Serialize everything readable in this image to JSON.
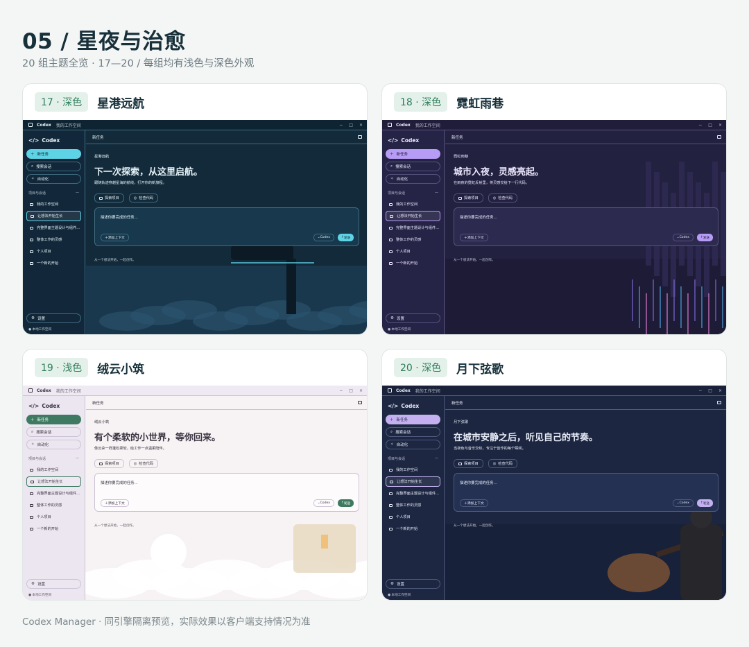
{
  "page": {
    "title": "05 / 星夜与治愈",
    "subtitle": "20 组主题全览 · 17—20 / 每组均有浅色与深色外观",
    "footer": "Codex Manager · 同引擎隔离预览，实际效果以客户端支持情况为准"
  },
  "ui": {
    "app_name": "Codex",
    "workspace": "我的工作空间",
    "new_task": "新任务",
    "search": "搜索会话",
    "automation": "自动化",
    "projects_section": "项目与会话",
    "projects": [
      "我的工作空间",
      "让想法开始生长",
      "完整界面主题设计与组件...",
      "整体工作的灵感",
      "个人项目",
      "一个新的开始"
    ],
    "settings": "设置",
    "local": "本地工作空间",
    "main_header": "新任务",
    "pill_project": "探索项目",
    "pill_review": "检查代码",
    "composer_placeholder": "描述你要完成的任务...",
    "add_context": "添加上下文",
    "model": "Codex",
    "send": "发送",
    "hint": "从一个想法开始，一起创作。"
  },
  "cards": [
    {
      "badge": "17 · 深色",
      "name": "星港远航",
      "kicker": "星港远航",
      "headline": "下一次探索，从这里启航。",
      "desc": "跟随轨迹穿越星海的航线，打开你的新旅程。",
      "colors": {
        "bg": "#132a3a",
        "sidebar": "#12283a",
        "titlebar": "#0f2433",
        "text": "#e6f3f8",
        "accent": "#5fd3e6",
        "accent_text": "#0d2533",
        "line": "#3f6c80",
        "composer": "#18394d"
      }
    },
    {
      "badge": "18 · 深色",
      "name": "霓虹雨巷",
      "kicker": "霓虹雨巷",
      "headline": "城市入夜，灵感亮起。",
      "desc": "在雨夜的霓虹反射里，将灵感交给下一行代码。",
      "colors": {
        "bg": "#22213f",
        "sidebar": "#262446",
        "titlebar": "#1f1d3a",
        "text": "#ece8ff",
        "accent": "#b69cf4",
        "accent_text": "#231d3d",
        "line": "#58527e",
        "composer": "#2c2a4e"
      }
    },
    {
      "badge": "19 · 浅色",
      "name": "绒云小筑",
      "kicker": "绒云小筑",
      "headline": "有个柔软的小世界，等你回来。",
      "desc": "像云朵一样蓬松柔软，给工作一点温柔陪伴。",
      "colors": {
        "bg": "#f7f3f4",
        "sidebar": "#ece6f0",
        "titlebar": "#eee9f2",
        "text": "#3a3240",
        "accent": "#3e7a62",
        "accent_text": "#ffffff",
        "line": "#cdc2d6",
        "composer": "#fdfbfc"
      }
    },
    {
      "badge": "20 · 深色",
      "name": "月下弦歌",
      "kicker": "月下弦歌",
      "headline": "在城市安静之后，听见自己的节奏。",
      "desc": "当夜色与音乐交织，专注于创作的每个瞬间。",
      "colors": {
        "bg": "#1c2640",
        "sidebar": "#1d2742",
        "titlebar": "#19223a",
        "text": "#e7ebf7",
        "accent": "#c4b0f0",
        "accent_text": "#1e2540",
        "line": "#4e5a7e",
        "composer": "#243152"
      }
    }
  ]
}
